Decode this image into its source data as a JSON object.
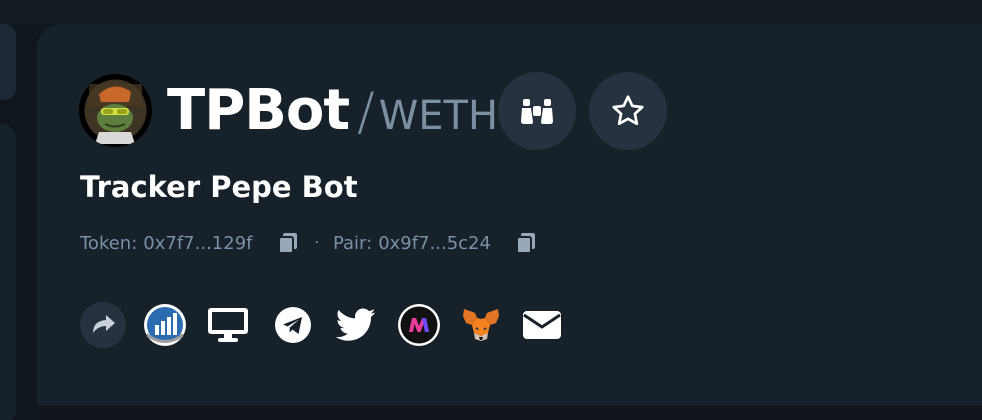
{
  "token": {
    "symbol": "TPBot",
    "separator": "/",
    "quote_symbol": "WETH",
    "name": "Tracker Pepe Bot"
  },
  "addresses": {
    "token_label": "Token:",
    "token_value": "0x7f7...129f",
    "pair_label": "Pair:",
    "pair_value": "0x9f7...5c24",
    "separator": "·"
  },
  "colors": {
    "background": "#0f161d",
    "card": "#16212a",
    "muted_text": "#7e8ea3",
    "circle_button": "#26323e"
  },
  "icons": {
    "watch": "binoculars-icon",
    "favorite": "star-icon",
    "copy": "copy-icon",
    "share": "share-icon",
    "chart": "chart-icon",
    "website": "monitor-icon",
    "telegram": "telegram-icon",
    "twitter": "twitter-icon",
    "dex": "m-logo-icon",
    "metamask": "metamask-fox-icon",
    "email": "email-icon"
  }
}
